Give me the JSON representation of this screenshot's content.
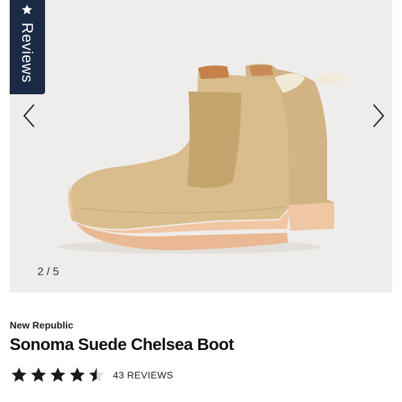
{
  "reviews_tab": {
    "label": "Reviews",
    "icon": "star-icon"
  },
  "gallery": {
    "counter": "2 / 5",
    "prev_icon": "chevron-left-icon",
    "next_icon": "chevron-right-icon",
    "image": "tan-suede-chelsea-boots"
  },
  "product": {
    "brand": "New Republic",
    "title": "Sonoma Suede Chelsea Boot",
    "rating": 4.5,
    "reviews_label": "43 REVIEWS"
  },
  "colors": {
    "navy": "#1b2a44",
    "image_bg": "#efedeb",
    "suede": "#d9bd8c"
  }
}
